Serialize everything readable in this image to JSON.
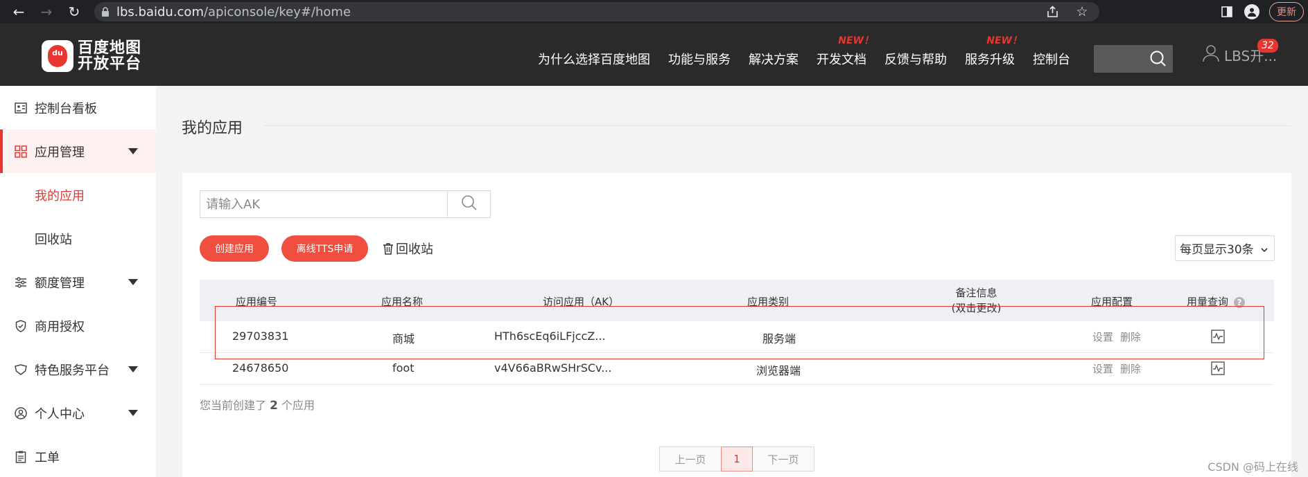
{
  "browser": {
    "url_host": "lbs.baidu.com",
    "url_path": "/apiconsole/key#/home",
    "update_label": "更新"
  },
  "header": {
    "logo_line1": "百度地图",
    "logo_line2": "开放平台",
    "logo_pin_text": "du",
    "nav": [
      {
        "label": "为什么选择百度地图",
        "new": ""
      },
      {
        "label": "功能与服务",
        "new": ""
      },
      {
        "label": "解决方案",
        "new": ""
      },
      {
        "label": "开发文档",
        "new": "NEW！"
      },
      {
        "label": "反馈与帮助",
        "new": ""
      },
      {
        "label": "服务升级",
        "new": "NEW！"
      },
      {
        "label": "控制台",
        "new": ""
      }
    ],
    "user_name": "LBS开...",
    "notification_count": "32"
  },
  "sidebar": {
    "items": [
      {
        "label": "控制台看板",
        "icon": "dashboard-icon"
      },
      {
        "label": "应用管理",
        "icon": "grid-icon"
      },
      {
        "label": "我的应用"
      },
      {
        "label": "回收站"
      },
      {
        "label": "额度管理",
        "icon": "sliders-icon"
      },
      {
        "label": "商用授权",
        "icon": "shield-icon"
      },
      {
        "label": "特色服务平台",
        "icon": "service-icon"
      },
      {
        "label": "个人中心",
        "icon": "user-icon"
      },
      {
        "label": "工单",
        "icon": "ticket-icon"
      }
    ]
  },
  "main": {
    "title": "我的应用",
    "search_placeholder": "请输入AK",
    "create_app": "创建应用",
    "tts_apply": "离线TTS申请",
    "recycle": "回收站",
    "per_page": "每页显示30条",
    "columns": [
      "应用编号",
      "应用名称",
      "访问应用（AK）",
      "应用类别",
      "备注信息",
      "(双击更改)",
      "应用配置",
      "用量查询"
    ],
    "rows": [
      {
        "id": "29703831",
        "name": "商城",
        "ak": "HTh6scEq6iLFjccZ...",
        "type": "服务端",
        "note": "",
        "setting": "设置",
        "delete": "删除"
      },
      {
        "id": "24678650",
        "name": "foot",
        "ak": "v4V66aBRwSHrSCv...",
        "type": "浏览器端",
        "note": "",
        "setting": "设置",
        "delete": "删除"
      }
    ],
    "count_prefix": "您当前创建了",
    "count": "2",
    "count_suffix": "个应用",
    "pager": {
      "prev": "上一页",
      "current": "1",
      "next": "下一页"
    }
  },
  "watermark": "CSDN @码上在线",
  "colors": {
    "accent": "#e9352f",
    "header_bg": "#2a2a2a"
  }
}
